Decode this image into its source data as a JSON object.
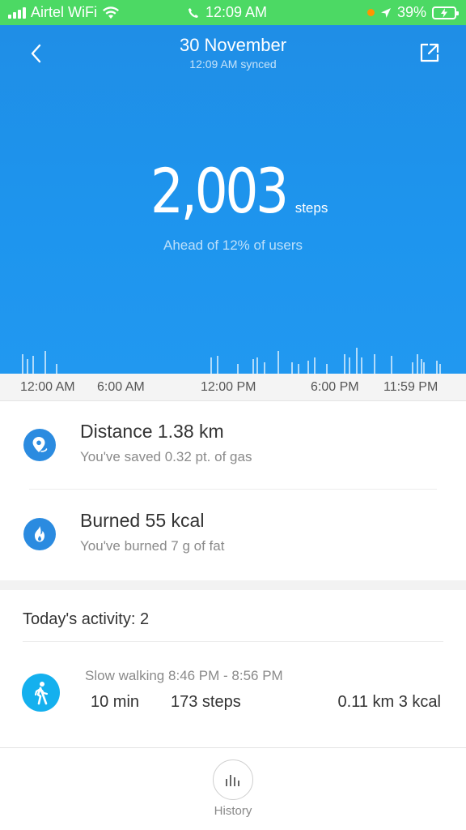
{
  "status_bar": {
    "carrier": "Airtel WiFi",
    "time": "12:09 AM",
    "battery": "39%",
    "color": "#4cd964"
  },
  "header": {
    "date": "30 November",
    "synced": "12:09 AM synced",
    "back_icon": "chevron-left-icon",
    "share_icon": "share-icon",
    "color": "#1e95ee"
  },
  "summary": {
    "steps": "2,003",
    "steps_unit": "steps",
    "rank": "Ahead of 12% of users"
  },
  "activity_bars": [
    0.6,
    0.45,
    0.55,
    0.7,
    0.3,
    0.5,
    0.55,
    0.3,
    0.45,
    0.5,
    0.35,
    0.7,
    0.35,
    0.3,
    0.4,
    0.5,
    0.3,
    0.6,
    0.5,
    0.8,
    0.5,
    0.6,
    0.55,
    0.35,
    0.6,
    0.45,
    0.35,
    0.4,
    0.3
  ],
  "time_axis": [
    "12:00 AM",
    "6:00 AM",
    "12:00 PM",
    "6:00 PM",
    "11:59 PM"
  ],
  "stats": [
    {
      "icon": "location-icon",
      "title": "Distance  1.38 km",
      "subtitle": "You've saved 0.32 pt. of gas"
    },
    {
      "icon": "flame-icon",
      "title": "Burned  55 kcal",
      "subtitle": "You've burned 7 g of fat"
    }
  ],
  "activity": {
    "title": "Today's activity: 2",
    "items": [
      {
        "icon": "walking-icon",
        "name": "Slow walking 8:46 PM - 8:56 PM",
        "duration": "10  min",
        "steps": "173 steps",
        "distance_kcal": "0.11 km 3 kcal"
      }
    ]
  },
  "bottom": {
    "history_label": "History",
    "history_icon": "bar-chart-icon"
  }
}
